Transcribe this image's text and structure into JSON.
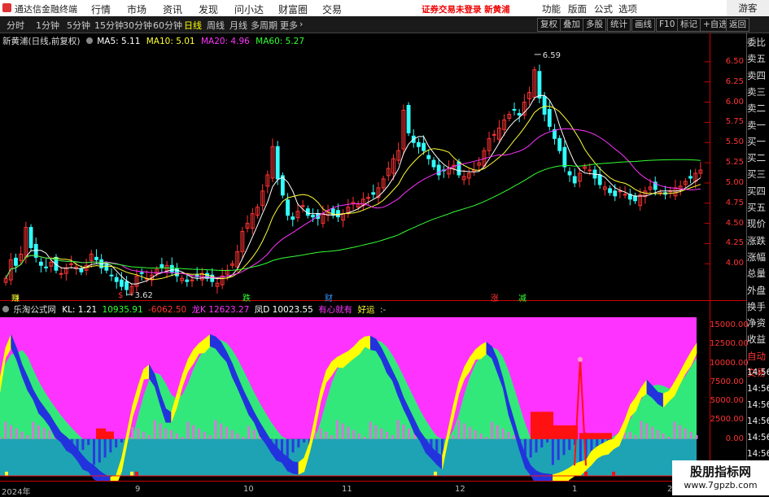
{
  "titlebar": {
    "title": "通达信金融终端",
    "menus": [
      "行情",
      "市场",
      "资讯",
      "发现",
      "问小达",
      "财富圈",
      "交易"
    ],
    "warning": "证券交易未登录  新黄浦",
    "tools": [
      "功能",
      "版面",
      "公式",
      "选项"
    ],
    "guest": "游客"
  },
  "toolbar": {
    "periods": [
      "分时",
      "1分钟",
      "5分钟",
      "15分钟",
      "30分钟",
      "60分钟",
      "日线",
      "周线",
      "月线",
      "多周期",
      "更多"
    ],
    "active_period": "日线",
    "right_buttons": [
      "复权",
      "叠加",
      "多股",
      "统计",
      "画线",
      "F10",
      "标记",
      "+自选",
      "返回"
    ]
  },
  "kline_header": {
    "stock": "新黄浦(日线,前复权)",
    "ma5": "MA5: 5.11",
    "ma10": "MA10: 5.01",
    "ma20": "MA20: 4.96",
    "ma60": "MA60: 5.27"
  },
  "indicator_header": {
    "name": "乐淘公式网",
    "kl": "KL: 1.21",
    "v1": "10935.91",
    "v2": "-6062.50",
    "long_label": "龙K",
    "long_val": "12623.27",
    "feng": "凤D",
    "feng_val": "10023.55",
    "note": "有心就有",
    "good": "好运",
    "extra": ":-"
  },
  "right_panel": [
    "委比",
    "卖五",
    "卖四",
    "卖三",
    "卖二",
    "卖一",
    "买一",
    "买二",
    "买三",
    "买四",
    "买五",
    "现价",
    "涨跌",
    "涨幅",
    "总量",
    "外盘",
    "换手",
    "净资",
    "收益",
    "自动",
    "交易"
  ],
  "right_panel_times": [
    "14:56",
    "14:56",
    "14:56",
    "14:56",
    "14:56",
    "14:56",
    "14:56",
    "14:5"
  ],
  "signals": [
    {
      "text": "赚",
      "color": "#ff3"
    },
    {
      "text": "$",
      "color": "#f33"
    },
    {
      "text": "跌",
      "color": "#3f3"
    },
    {
      "text": "财",
      "color": "#39f"
    },
    {
      "text": "涨",
      "color": "#f33"
    },
    {
      "text": "减",
      "color": "#3f3"
    }
  ],
  "date_labels": [
    "2024年",
    "9",
    "10",
    "11",
    "12",
    "1",
    "2"
  ],
  "watermark": {
    "title": "股朋指标网",
    "url": "www.7gpzb.com"
  },
  "colors": {
    "up": "#ff3333",
    "down": "#33ffff",
    "ma5": "#ffffff",
    "ma10": "#ffff33",
    "ma20": "#ff33ff",
    "ma60": "#33ff33",
    "magenta": "#ff33ff",
    "green": "#33e87a",
    "teal": "#1ea3b5",
    "yellow": "#ffff00",
    "blue": "#2233dd"
  },
  "chart_data": [
    {
      "type": "candlestick",
      "title": "新黄浦(日线,前复权)",
      "ylim": [
        3.55,
        6.7
      ],
      "y_ticks": [
        4.0,
        4.25,
        4.5,
        4.75,
        5.0,
        5.25,
        5.5,
        5.75,
        6.0,
        6.25,
        6.5
      ],
      "annotations": [
        {
          "text": "6.59",
          "value": 6.59
        },
        {
          "text": "3.62",
          "value": 3.62
        }
      ],
      "closes": [
        3.82,
        4.05,
        3.98,
        4.12,
        4.45,
        4.2,
        4.08,
        3.98,
        3.95,
        4.02,
        3.92,
        3.88,
        3.95,
        4.0,
        3.96,
        3.9,
        3.98,
        4.12,
        4.05,
        3.95,
        3.92,
        3.85,
        3.78,
        3.72,
        3.68,
        3.72,
        3.85,
        3.88,
        3.82,
        3.86,
        3.93,
        3.95,
        3.98,
        3.9,
        3.85,
        3.82,
        3.78,
        3.8,
        3.84,
        3.88,
        3.82,
        3.78,
        3.76,
        3.85,
        3.92,
        4.0,
        4.15,
        4.4,
        4.5,
        4.62,
        4.7,
        4.9,
        5.1,
        5.45,
        5.05,
        4.85,
        4.6,
        4.55,
        4.65,
        4.72,
        4.6,
        4.58,
        4.56,
        4.62,
        4.66,
        4.6,
        4.58,
        4.62,
        4.7,
        4.76,
        4.74,
        4.8,
        4.82,
        4.86,
        4.94,
        5.05,
        5.18,
        5.3,
        5.4,
        5.9,
        5.62,
        5.5,
        5.45,
        5.4,
        5.3,
        5.2,
        5.1,
        5.15,
        5.18,
        5.22,
        5.1,
        5.08,
        5.12,
        5.16,
        5.25,
        5.4,
        5.55,
        5.6,
        5.68,
        5.78,
        5.85,
        5.9,
        5.84,
        6.0,
        6.12,
        6.4,
        6.05,
        5.85,
        5.7,
        5.55,
        5.4,
        5.2,
        5.1,
        5.0,
        5.12,
        5.2,
        5.16,
        5.06,
        4.98,
        4.95,
        4.88,
        4.84,
        4.9,
        4.86,
        4.8,
        4.78,
        4.85,
        4.9,
        4.95,
        4.92,
        4.88,
        4.86,
        4.9,
        4.94,
        4.96,
        5.02,
        5.06,
        5.12,
        5.16
      ],
      "series": [
        {
          "name": "MA5",
          "value": 5.11
        },
        {
          "name": "MA10",
          "value": 5.01
        },
        {
          "name": "MA20",
          "value": 4.96
        },
        {
          "name": "MA60",
          "value": 5.27
        }
      ]
    },
    {
      "type": "area",
      "title": "乐淘公式网",
      "ylim": [
        -5500,
        16500
      ],
      "y_ticks": [
        15000,
        12500,
        10000,
        7500,
        5000,
        2500,
        0
      ],
      "series": [
        {
          "name": "龙K",
          "value": 12623.27
        },
        {
          "name": "凤D",
          "value": 10023.55
        }
      ],
      "curve": [
        8000,
        12000,
        13800,
        12000,
        9800,
        8200,
        6500,
        5200,
        4200,
        3200,
        2000,
        900,
        300,
        -400,
        -1300,
        -2200,
        -3000,
        -3500,
        -4200,
        -4700,
        -5000,
        -4800,
        -2500,
        1000,
        4500,
        7000,
        9200,
        9800,
        8500,
        6000,
        4000,
        3500,
        6000,
        8500,
        10500,
        11800,
        12600,
        13200,
        13800,
        13500,
        12800,
        11500,
        10000,
        8200,
        6500,
        5000,
        3500,
        2200,
        1000,
        -200,
        -1000,
        -1800,
        -2400,
        -3000,
        -3100,
        -2500,
        -500,
        3000,
        6500,
        9000,
        10200,
        10800,
        11200,
        11600,
        12200,
        13000,
        13500,
        13600,
        13200,
        12000,
        10500,
        9000,
        7500,
        5500,
        4000,
        2500,
        1000,
        0,
        -1000,
        -1800,
        -2200,
        1000,
        4500,
        7500,
        9500,
        10800,
        11800,
        12400,
        12800,
        12200,
        10500,
        8000,
        5000,
        2500,
        0,
        -2000,
        -3500,
        -4200,
        -4500,
        -4600,
        -4700,
        -4500,
        -4200,
        -3800,
        -3300,
        -3000,
        -2800,
        -1600,
        -1000,
        -600,
        -200,
        0,
        900,
        2500,
        4500,
        5500,
        6800,
        7800,
        7000,
        6200,
        6000,
        6300,
        7500,
        8800,
        10200,
        11500,
        12600
      ]
    }
  ]
}
